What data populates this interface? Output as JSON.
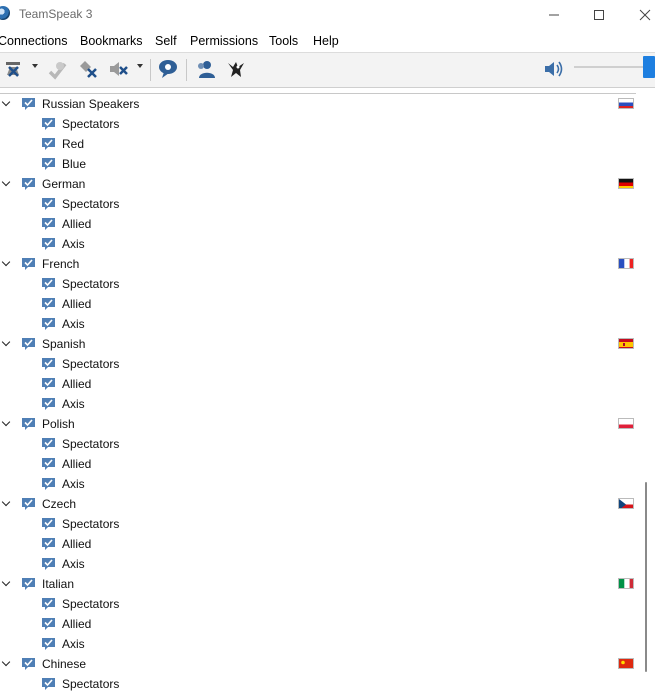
{
  "window": {
    "title": "TeamSpeak 3"
  },
  "menu": [
    "Connections",
    "Bookmarks",
    "Self",
    "Permissions",
    "Tools",
    "Help"
  ],
  "toolbar": {
    "icons": [
      "disconnect-icon",
      "away-icon",
      "mute-microphone-icon",
      "mute-speakers-icon",
      "chat-icon",
      "contacts-icon",
      "whisper-icon"
    ],
    "volume_icon": "speaker-volume-icon"
  },
  "channels": [
    {
      "name": "Russian Speakers",
      "flag": "ru",
      "subchannels": [
        "Spectators",
        "Red",
        "Blue"
      ]
    },
    {
      "name": "German",
      "flag": "de",
      "subchannels": [
        "Spectators",
        "Allied",
        "Axis"
      ]
    },
    {
      "name": "French",
      "flag": "fr",
      "subchannels": [
        "Spectators",
        "Allied",
        "Axis"
      ]
    },
    {
      "name": "Spanish",
      "flag": "es",
      "subchannels": [
        "Spectators",
        "Allied",
        "Axis"
      ]
    },
    {
      "name": "Polish",
      "flag": "pl",
      "subchannels": [
        "Spectators",
        "Allied",
        "Axis"
      ]
    },
    {
      "name": "Czech",
      "flag": "cz",
      "subchannels": [
        "Spectators",
        "Allied",
        "Axis"
      ]
    },
    {
      "name": "Italian",
      "flag": "it",
      "subchannels": [
        "Spectators",
        "Allied",
        "Axis"
      ]
    },
    {
      "name": "Chinese",
      "flag": "cn",
      "subchannels": [
        "Spectators"
      ]
    }
  ],
  "colors": {
    "channel_icon": "#4f7fb5",
    "volume_accent": "#1e7fe0"
  }
}
